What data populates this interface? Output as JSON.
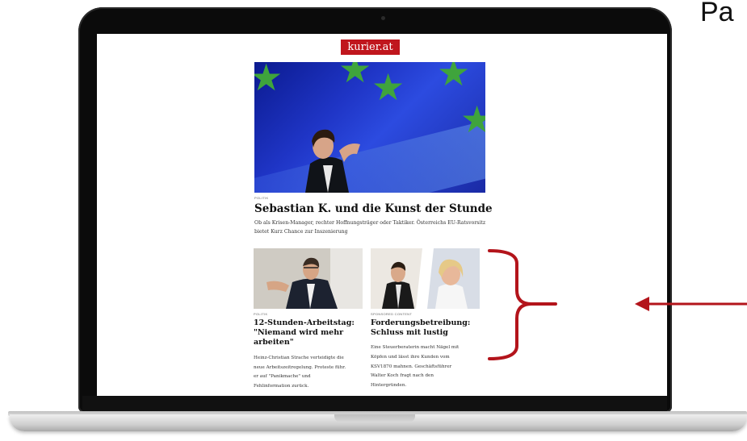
{
  "site": {
    "logo": "kurier.at"
  },
  "hero_article": {
    "category": "POLITIK",
    "headline": "Sebastian K. und die Kunst der Stunde",
    "teaser": "Ob als Krisen-Manager, rechter Hoffnungsträger oder Taktiker. Österreichs EU-Ratsvorsitz bietet Kurz Chance zur Inszenierung"
  },
  "articles": [
    {
      "category": "POLITIK",
      "headline_lines": [
        "12-Stunden-Arbeitstag:",
        "\"Niemand wird mehr",
        "arbeiten\""
      ],
      "teaser_lines": [
        "Heinz-Christian Strache verteidigte die",
        "neue Arbeitszeitregelung. Proteste führ.",
        "er auf \"Panikmache\" und",
        "Fehlinformation zurück."
      ]
    },
    {
      "category": "SPONSORED CONTENT",
      "headline_lines": [
        "Forderungsbetreibung:",
        "Schluss mit lustig"
      ],
      "teaser_lines": [
        "Eine Steuerberaterin macht Nägel mit",
        "Köpfen und lässt ihre Kunden vom",
        "KSV1870 mahnen. Geschäftsführer",
        "Walter Koch fragt nach den",
        "Hintergründen."
      ]
    }
  ],
  "overlay": {
    "label": "Pa"
  },
  "colors": {
    "brand": "#c0161d",
    "annotation": "#b3141b"
  }
}
